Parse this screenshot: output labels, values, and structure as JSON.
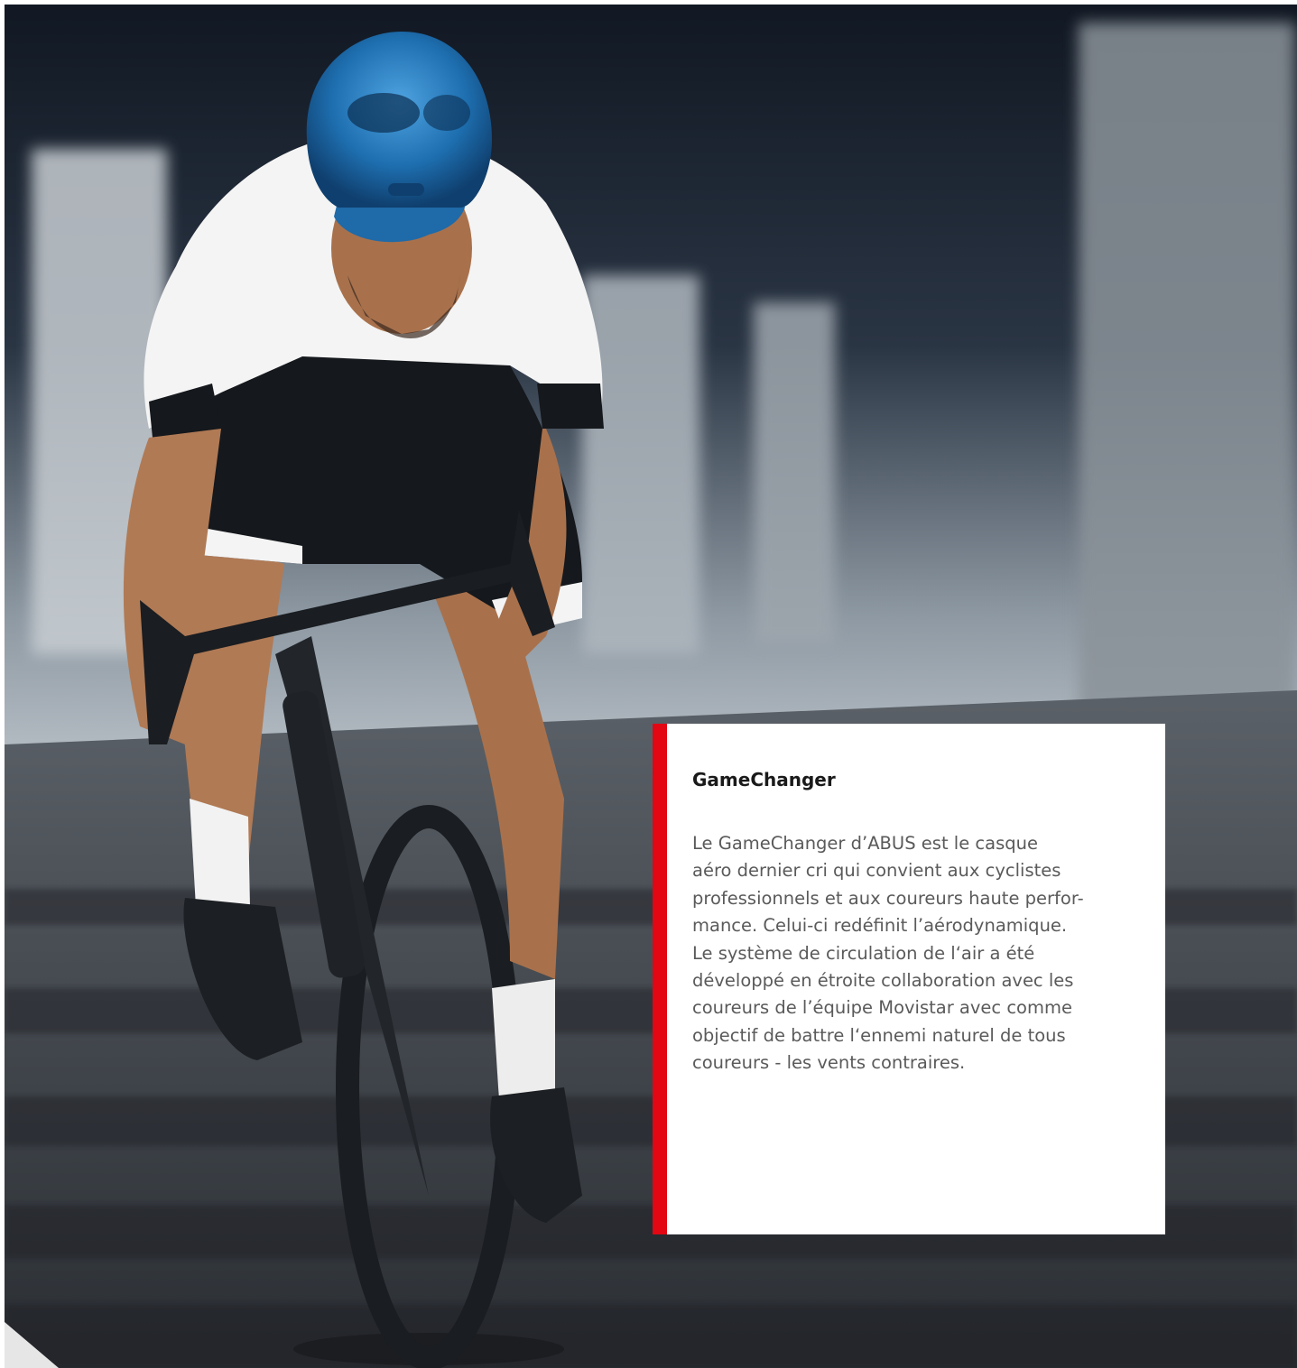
{
  "card": {
    "title": "GameChanger",
    "body_lines": [
      "Le GameChanger d’ABUS est le casque",
      "aéro dernier cri qui convient aux cyclistes",
      "professionnels et aux coureurs haute perfor-",
      "mance. Celui-ci redéfinit l’aérodynamique.",
      "Le système de circulation de l‘air a été",
      "développé en étroite collaboration avec les",
      "coureurs de l’équipe Movistar avec comme",
      "objectif de battre l‘ennemi naturel de tous",
      "coureurs - les vents contraires."
    ]
  },
  "colors": {
    "accent": "#e30613",
    "card_background": "#ffffff",
    "title_text": "#1a1a1a",
    "body_text": "#5a5a5a",
    "helmet": "#1e6fb0",
    "jersey": "#f4f4f4",
    "shorts": "#15181c",
    "skin": "#b07a55",
    "bike": "#1a1d21"
  },
  "icons": {
    "photo": "cyclist-photo"
  }
}
